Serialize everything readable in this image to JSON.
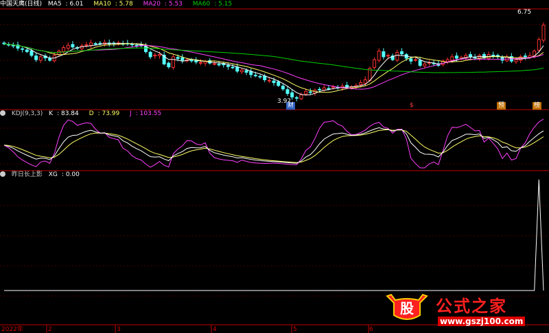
{
  "window": {
    "title": "中国天鹰(日线)"
  },
  "indicators": {
    "ma5": {
      "label": "MA5",
      "value": "6.01",
      "color": "#ffffff"
    },
    "ma10": {
      "label": "MA10",
      "value": "5.78",
      "color": "#ffff66"
    },
    "ma20": {
      "label": "MA20",
      "value": "5.53",
      "color": "#ff40ff"
    },
    "ma60": {
      "label": "MA60",
      "value": "5.15",
      "color": "#00d000"
    }
  },
  "kdj": {
    "title": "KDJ(9,3,3)",
    "k": {
      "label": "K",
      "value": "83.84",
      "color": "#ffffff"
    },
    "d": {
      "label": "D",
      "value": "73.99",
      "color": "#ffff66"
    },
    "j": {
      "label": "J",
      "value": "103.55",
      "color": "#ff40ff"
    }
  },
  "custom": {
    "title": "昨日长上影",
    "xg_label": "XG",
    "xg_value": "0.00"
  },
  "annotations": {
    "high_label": "6.75",
    "low_label": "3.92",
    "marks": [
      {
        "text": "财",
        "bg": "#3060c0"
      },
      {
        "text": "$",
        "bg": ""
      },
      {
        "text": "预",
        "bg": "#c07000"
      },
      {
        "text": "榜",
        "bg": "#c07000"
      }
    ]
  },
  "x_axis": {
    "year": "2022年",
    "months": [
      "2",
      "3",
      "4",
      "5",
      "6"
    ]
  },
  "logo": {
    "word": "公式之家",
    "url": "www.gszj100.com",
    "badge": "股"
  },
  "colors": {
    "up": "#ff3232",
    "down": "#54fcfc",
    "grid": "#8b0000",
    "divider": "#c00000"
  },
  "chart_data": [
    {
      "type": "candlestick",
      "x": [
        1,
        2,
        3,
        4,
        5,
        6,
        7,
        8,
        9,
        10,
        11,
        12,
        13,
        14,
        15,
        16,
        17,
        18,
        19,
        20,
        21,
        22,
        23,
        24,
        25,
        26,
        27,
        28,
        29,
        30,
        31,
        32,
        33,
        34,
        35,
        36,
        37,
        38,
        39,
        40,
        41,
        42,
        43,
        44,
        45,
        46,
        47,
        48,
        49,
        50,
        51,
        52,
        53,
        54,
        55,
        56,
        57,
        58,
        59,
        60,
        61,
        62,
        63,
        64,
        65,
        66,
        67,
        68,
        69,
        70,
        71,
        72,
        73,
        74,
        75,
        76,
        77,
        78,
        79,
        80,
        81,
        82,
        83,
        84,
        85,
        86,
        87,
        88,
        89,
        90,
        91,
        92,
        93,
        94,
        95,
        96,
        97,
        98,
        99,
        100,
        101,
        102,
        103,
        104,
        105,
        106,
        107,
        108,
        109,
        110,
        111,
        112,
        113,
        114,
        115,
        116,
        117,
        118,
        119
      ],
      "close": [
        5.85,
        5.82,
        5.78,
        5.7,
        5.66,
        5.58,
        5.45,
        5.3,
        5.4,
        5.36,
        5.28,
        5.45,
        5.6,
        5.72,
        5.8,
        5.74,
        5.7,
        5.78,
        5.82,
        5.88,
        5.84,
        5.86,
        5.9,
        5.85,
        5.86,
        5.88,
        5.84,
        5.86,
        5.82,
        5.8,
        5.78,
        5.58,
        5.4,
        5.46,
        5.48,
        5.15,
        5.05,
        5.4,
        5.34,
        5.28,
        5.3,
        5.26,
        5.22,
        5.2,
        5.24,
        5.18,
        5.16,
        5.14,
        5.12,
        5.06,
        5.02,
        4.9,
        4.94,
        4.86,
        4.78,
        4.74,
        4.7,
        4.6,
        4.58,
        4.5,
        4.4,
        4.28,
        4.12,
        4.0,
        3.96,
        4.08,
        4.2,
        4.16,
        4.24,
        4.26,
        4.32,
        4.3,
        4.36,
        4.34,
        4.38,
        4.34,
        4.36,
        4.4,
        4.5,
        4.6,
        5.0,
        5.3,
        5.6,
        5.4,
        5.45,
        5.3,
        5.55,
        5.5,
        5.35,
        5.25,
        5.3,
        5.1,
        5.15,
        5.2,
        5.18,
        5.1,
        5.25,
        5.3,
        5.4,
        5.35,
        5.38,
        5.45,
        5.4,
        5.38,
        5.45,
        5.36,
        5.48,
        5.42,
        5.4,
        5.28,
        5.38,
        5.25,
        5.3,
        5.4,
        5.4,
        5.44,
        5.6,
        6.0,
        6.5
      ],
      "high_label": 6.75,
      "low_label": 3.92,
      "ylim": [
        3.8,
        6.9
      ]
    },
    {
      "type": "line",
      "title": "KDJ(9,3,3)",
      "series": [
        {
          "name": "K",
          "last": 83.84
        },
        {
          "name": "D",
          "last": 73.99
        },
        {
          "name": "J",
          "last": 103.55
        }
      ],
      "ylim": [
        0,
        110
      ]
    },
    {
      "type": "line",
      "title": "昨日长上影",
      "series": [
        {
          "name": "XG",
          "values": [
            0,
            0,
            0,
            0,
            0,
            0,
            0,
            0,
            0,
            0,
            0,
            0,
            0,
            0,
            0,
            0,
            0,
            0,
            0,
            0,
            0,
            0,
            0,
            0,
            0,
            0,
            0,
            0,
            0,
            0,
            0,
            0,
            0,
            0,
            0,
            0,
            0,
            0,
            0,
            0,
            0,
            0,
            0,
            0,
            0,
            0,
            0,
            0,
            0,
            0,
            0,
            0,
            0,
            0,
            0,
            0,
            0,
            0,
            0,
            0,
            0,
            0,
            0,
            0,
            0,
            0,
            0,
            0,
            0,
            0,
            0,
            0,
            0,
            0,
            0,
            0,
            0,
            0,
            0,
            0,
            0,
            0,
            0,
            0,
            0,
            0,
            0,
            0,
            0,
            0,
            0,
            0,
            0,
            0,
            0,
            0,
            0,
            0,
            0,
            0,
            0,
            0,
            0,
            0,
            0,
            0,
            0,
            0,
            0,
            0,
            0,
            0,
            0,
            0,
            0,
            0,
            0,
            1,
            0
          ]
        }
      ],
      "ylim": [
        0,
        1
      ]
    }
  ]
}
